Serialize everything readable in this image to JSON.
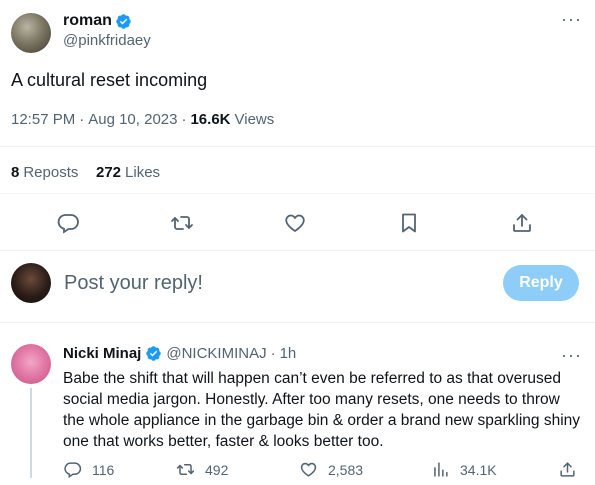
{
  "tweet": {
    "author_name": "roman",
    "handle": "@pinkfridaey",
    "text": "A cultural reset incoming",
    "time": "12:57 PM",
    "date": "Aug 10, 2023",
    "views_count": "16.6K",
    "views_label": "Views",
    "reposts_count": "8",
    "reposts_label": "Reposts",
    "likes_count": "272",
    "likes_label": "Likes",
    "more_label": "···"
  },
  "reply_box": {
    "placeholder": "Post your reply!",
    "button_label": "Reply"
  },
  "reply": {
    "author_name": "Nicki Minaj",
    "handle": "@NICKIMINAJ",
    "time": "1h",
    "text": "Babe the shift that will happen can’t even be referred to as that overused social media jargon. Honestly. After too many resets, one needs to throw the whole appliance in the garbage bin & order a brand new sparkling shiny one that works better, faster & looks better too.",
    "replies": "116",
    "reposts": "492",
    "likes": "2,583",
    "views": "34.1K",
    "more_label": "···"
  },
  "colors": {
    "accent": "#1d9bf0",
    "reply_button_disabled": "#8ecdf8",
    "muted_text": "#536471",
    "divider": "#eff3f4"
  }
}
